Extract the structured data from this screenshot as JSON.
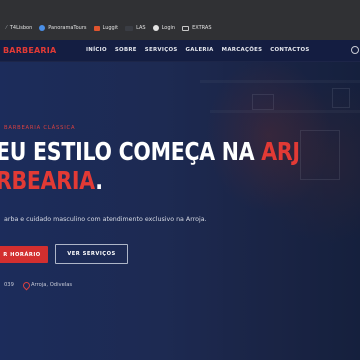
{
  "bookmarks": [
    {
      "label": "T4Lisbon",
      "icon": "slash-icon"
    },
    {
      "label": "PanoramaTours",
      "icon": "globe-icon"
    },
    {
      "label": "Luggit",
      "icon": "luggit-icon"
    },
    {
      "label": "LAS",
      "icon": "las-icon"
    },
    {
      "label": "Login",
      "icon": "login-icon"
    },
    {
      "label": "EXTRAS",
      "icon": "folder-icon"
    }
  ],
  "nav": {
    "logo": "BARBEARIA",
    "items": [
      "INÍCIO",
      "SOBRE",
      "SERVIÇOS",
      "GALERIA",
      "MARCAÇÕES",
      "CONTACTOS"
    ]
  },
  "hero": {
    "eyebrow": "BARBEARIA CLÁSSICA",
    "title_line1": "EU ESTILO COMEÇA NA ",
    "title_highlight": "ARJ",
    "title_line2": "RBEARIA",
    "title_dot": ".",
    "subtitle": "arba e cuidado masculino com atendimento exclusivo na Arroja.",
    "primary_button": "R HORÁRIO",
    "secondary_button": "VER SERVIÇOS",
    "meta_left": "039",
    "meta_location": "Arroja, Odivelas"
  },
  "colors": {
    "accent": "#e23a35",
    "hero_bg": "#1c2a55",
    "bookmarks_bg": "#303134"
  }
}
